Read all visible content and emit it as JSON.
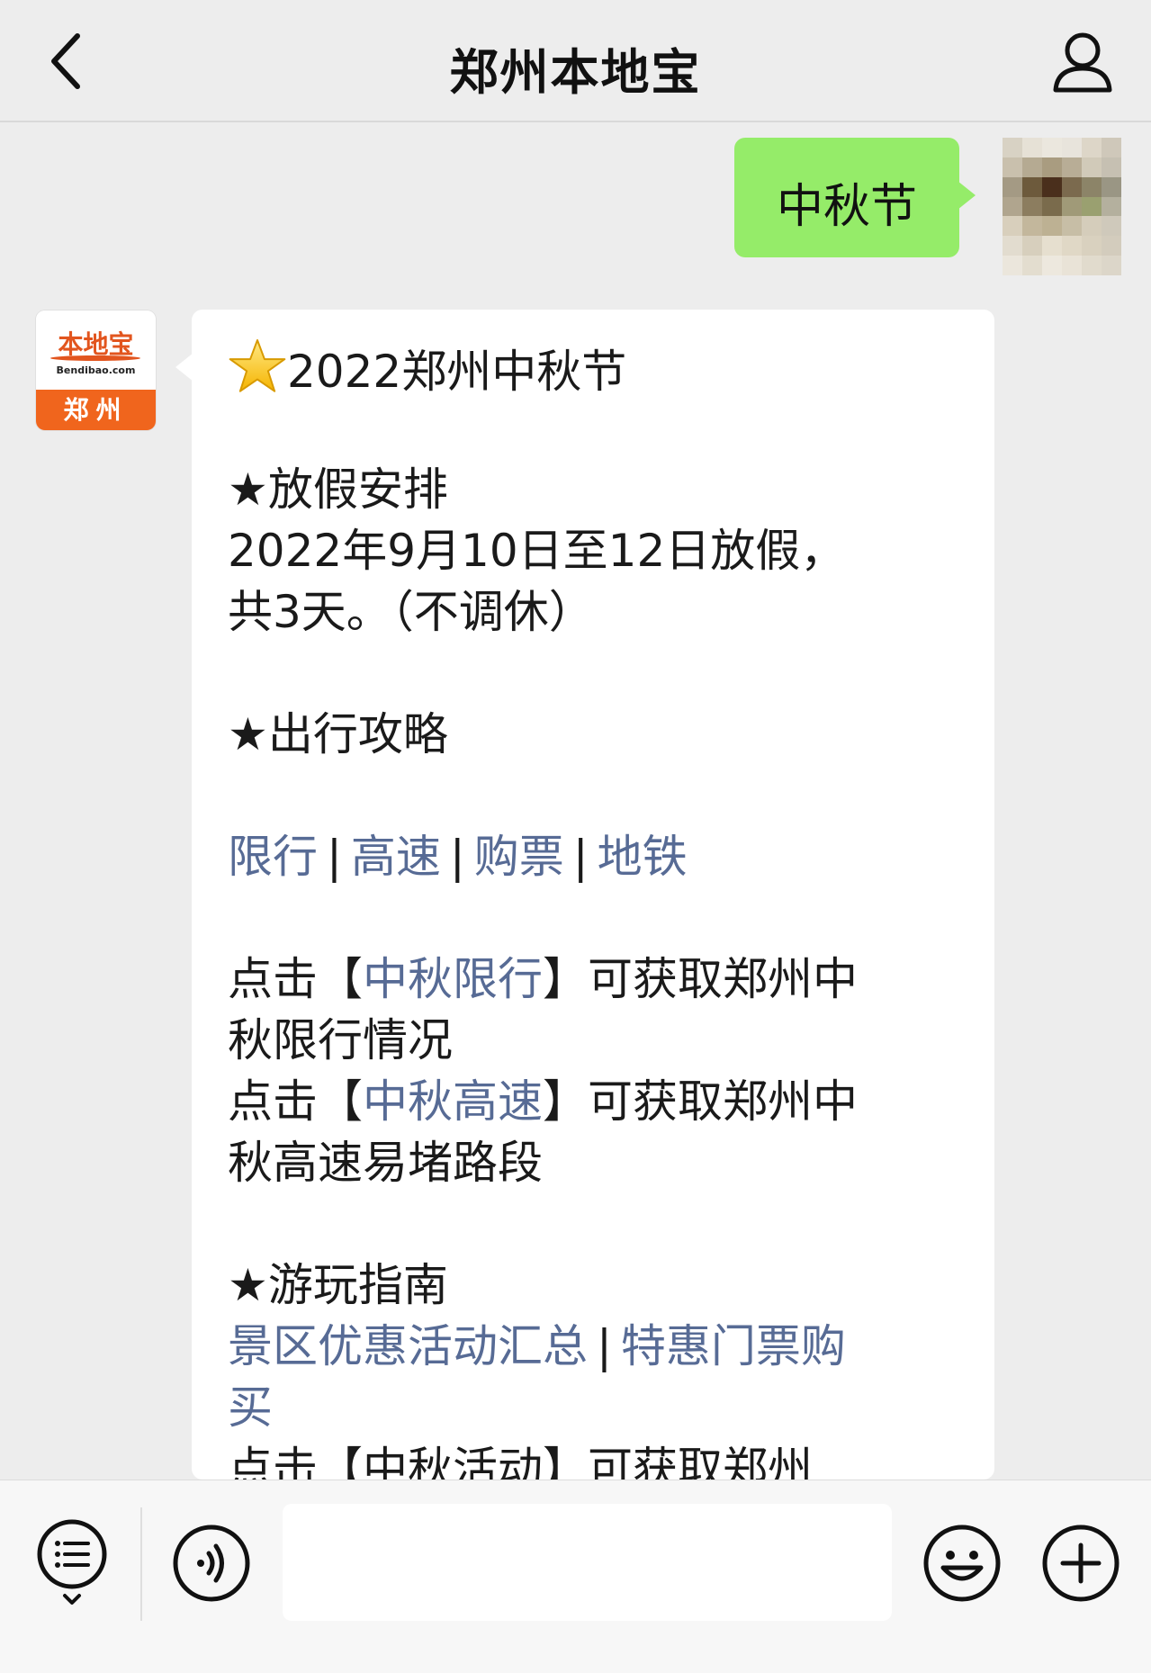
{
  "header": {
    "title": "郑州本地宝"
  },
  "sent_message": {
    "text": "中秋节"
  },
  "official_account": {
    "brand": "本地宝",
    "domain": "Bendibao.com",
    "city": "郑州"
  },
  "reply": {
    "title": "2022郑州中秋节",
    "holiday_heading": "★放假安排",
    "holiday_line1": "2022年9月10日至12日放假，",
    "holiday_line2": "共3天。（不调休）",
    "travel_heading": "★出行攻略",
    "travel_links": [
      "限行",
      "高速",
      "购票",
      "地铁"
    ],
    "separator": "|",
    "click_prefix": "点击【",
    "click_suffix": "】可获取郑州中",
    "item1_link": "中秋限行",
    "item1_cont": "秋限行情况",
    "item2_link": "中秋高速",
    "item2_cont": "秋高速易堵路段",
    "play_heading": "★游玩指南",
    "play_link1": "景区优惠活动汇总",
    "play_link2_a": "特惠门票购",
    "play_link2_b": "买",
    "partial_line": "点击【中秋活动】可获取郑州"
  },
  "colors": {
    "link": "#576b95",
    "sent_bubble": "#95ec69",
    "background": "#ededed",
    "brand_orange": "#f0651d"
  },
  "icons": {
    "back": "chevron-left-icon",
    "profile": "person-icon",
    "star": "star-emoji-icon",
    "menu": "list-menu-icon",
    "voice": "voice-icon",
    "emoji": "smile-icon",
    "plus": "plus-icon"
  }
}
